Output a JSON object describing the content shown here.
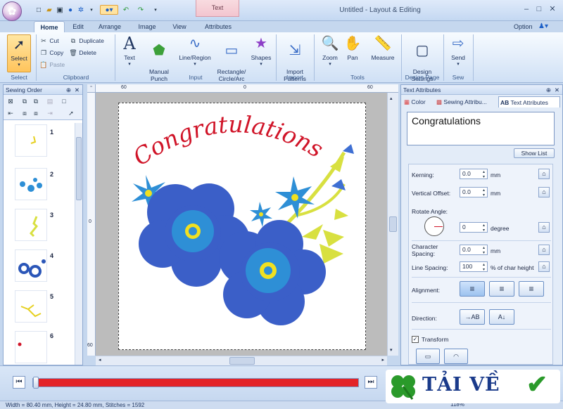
{
  "window": {
    "title": "Untitled - Layout & Editing",
    "context_tab": "Text"
  },
  "ribbon": {
    "tabs": [
      "Home",
      "Edit",
      "Arrange",
      "Image",
      "View",
      "Attributes"
    ],
    "option_label": "Option",
    "groups": {
      "select": {
        "label": "Select",
        "select_btn": "Select"
      },
      "clipboard": {
        "label": "Clipboard",
        "cut": "Cut",
        "copy": "Copy",
        "paste": "Paste",
        "duplicate": "Duplicate",
        "delete": "Delete"
      },
      "input": {
        "label": "Input",
        "text": "Text",
        "manual_punch": "Manual\nPunch",
        "line_region": "Line/Region",
        "rect": "Rectangle/\nCircle/Arc",
        "shapes": "Shapes"
      },
      "import": {
        "label": "Import",
        "import_patterns": "Import\nPatterns"
      },
      "tools": {
        "label": "Tools",
        "zoom": "Zoom",
        "pan": "Pan",
        "measure": "Measure"
      },
      "design_page": {
        "label": "Design Page",
        "design_settings": "Design\nSettings"
      },
      "sew": {
        "label": "Sew",
        "send": "Send"
      }
    }
  },
  "sewing_order": {
    "title": "Sewing Order",
    "items": [
      "1",
      "2",
      "3",
      "4",
      "5",
      "6"
    ]
  },
  "rulers": {
    "top": [
      "60",
      "0",
      "60"
    ],
    "left": [
      "0",
      "60"
    ]
  },
  "design": {
    "text": "Congratulations",
    "text_color": "#d01428",
    "flower_color": "#3b5fc8",
    "center_color": "#f0e020"
  },
  "text_attributes": {
    "title": "Text Attributes",
    "tabs": [
      "Color",
      "Sewing Attribu...",
      "Text Attributes"
    ],
    "text_value": "Congratulations",
    "show_list": "Show List",
    "kerning": {
      "label": "Kerning:",
      "value": "0.0",
      "unit": "mm"
    },
    "vertical_offset": {
      "label": "Vertical Offset:",
      "value": "0.0",
      "unit": "mm"
    },
    "rotate_angle": {
      "label": "Rotate Angle:",
      "value": "0",
      "unit": "degree"
    },
    "character_spacing": {
      "label": "Character\nSpacing:",
      "value": "0.0",
      "unit": "mm"
    },
    "line_spacing": {
      "label": "Line Spacing:",
      "value": "100",
      "unit": "% of char height"
    },
    "alignment_label": "Alignment:",
    "direction_label": "Direction:",
    "transform_label": "Transform",
    "transform_checked": true
  },
  "player": {
    "progress_fraction": 0.0
  },
  "status": {
    "text": "Width = 80.40 mm, Height = 24.80 mm, Stitches = 1592",
    "zoom": "118%"
  },
  "watermark": {
    "text": "TẢI VỀ"
  }
}
